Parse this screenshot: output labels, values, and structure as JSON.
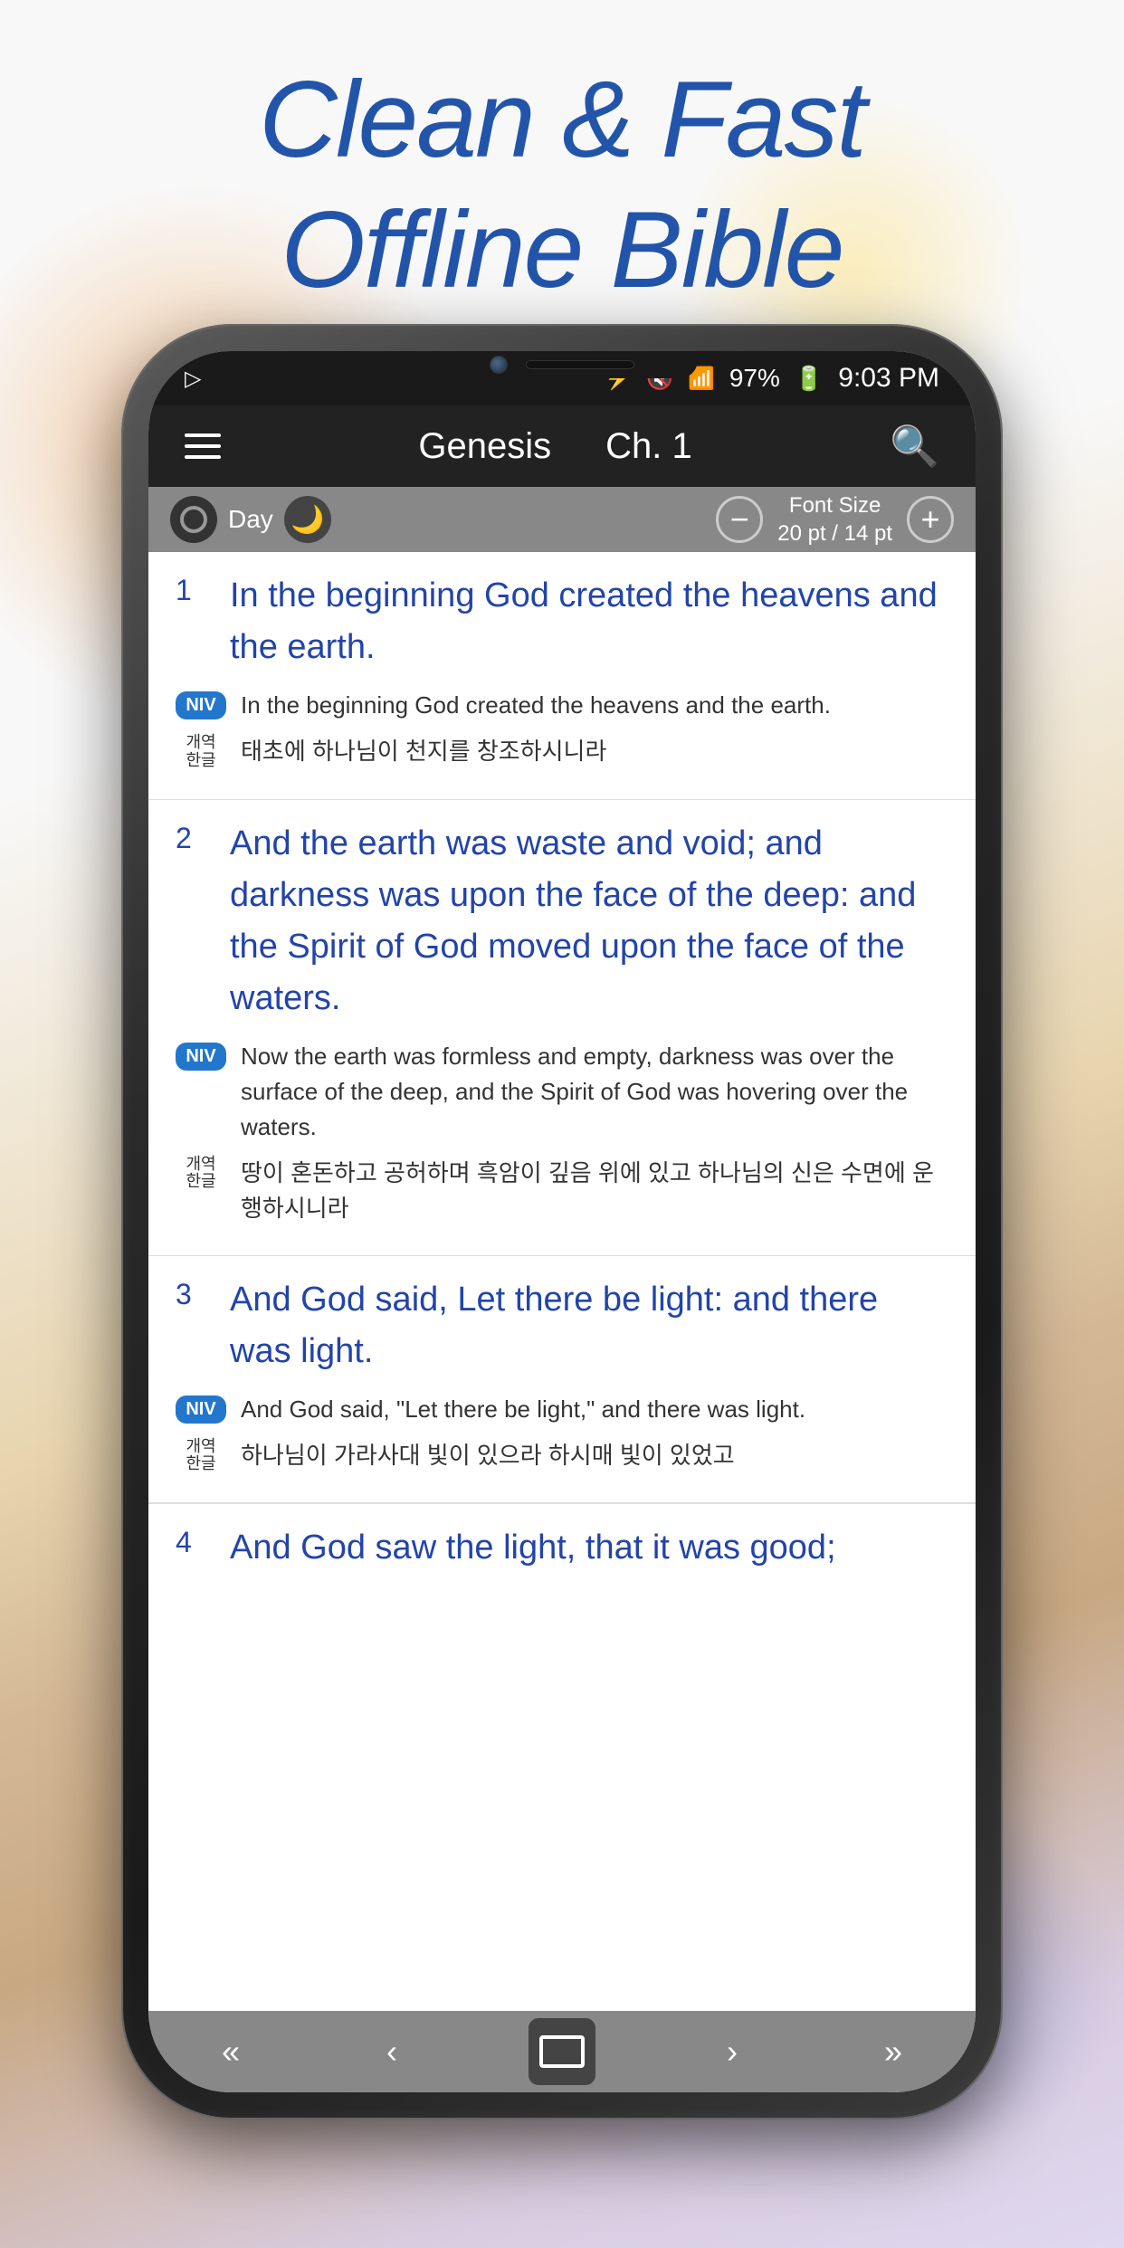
{
  "page": {
    "title_line1": "Clean & Fast",
    "title_line2": "Offline Bible"
  },
  "status_bar": {
    "time": "9:03 PM",
    "battery": "97%",
    "bluetooth": "BT",
    "sound_off": "🔇",
    "wifi": "WiFi",
    "signal": "Signal"
  },
  "header": {
    "book": "Genesis",
    "chapter": "Ch. 1",
    "menu_label": "menu",
    "search_label": "search"
  },
  "controls": {
    "day_label": "Day",
    "font_size_line1": "Font Size",
    "font_size_line2": "20 pt / 14 pt",
    "decrease_label": "−",
    "increase_label": "+"
  },
  "verses": [
    {
      "number": "1",
      "main_text": "In the beginning God created the heavens and the earth.",
      "niv_text": "In the beginning God created the heavens and the earth.",
      "korean_text": "태초에 하나님이 천지를 창조하시니라",
      "korean_badge_top": "개역",
      "korean_badge_bottom": "한글"
    },
    {
      "number": "2",
      "main_text": "And the earth was waste and void; and darkness was upon the face of the deep: and the Spirit of God moved upon the face of the waters.",
      "niv_text": "Now the earth was formless and empty, darkness was over the surface of the deep, and the Spirit of God was hovering over the waters.",
      "korean_text": "땅이 혼돈하고 공허하며 흑암이 깊음 위에 있고 하나님의 신은 수면에 운행하시니라",
      "korean_badge_top": "개역",
      "korean_badge_bottom": "한글"
    },
    {
      "number": "3",
      "main_text": "And God said, Let there be light: and there was light.",
      "niv_text": "And God said, \"Let there be light,\" and there was light.",
      "korean_text": "하나님이 가라사대 빛이 있으라 하시매 빛이 있었고",
      "korean_badge_top": "개역",
      "korean_badge_bottom": "한글"
    },
    {
      "number": "4",
      "main_text": "And God saw the light, that it was good;",
      "partial": true
    }
  ],
  "bottom_nav": {
    "first_label": "«",
    "prev_label": "‹",
    "center_label": "chapters",
    "next_label": "›",
    "last_label": "»"
  }
}
